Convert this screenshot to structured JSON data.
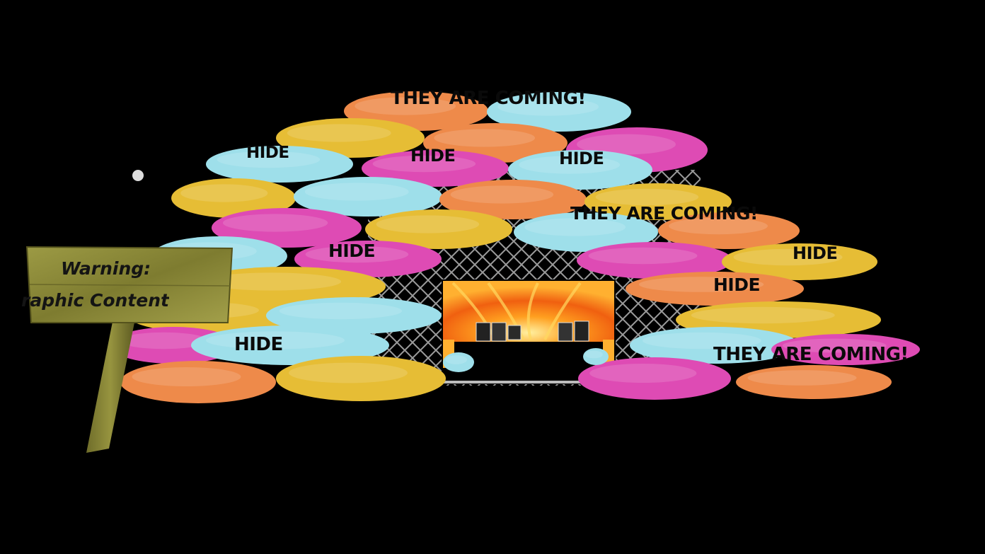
{
  "scene": {
    "banners": {
      "coming_1": "THEY ARE COMING!",
      "coming_2": "THEY ARE COMING!",
      "coming_3": "THEY ARE COMING!",
      "hide_1": "HIDE",
      "hide_2": "HIDE",
      "hide_3": "HIDE",
      "hide_4": "HIDE",
      "hide_5": "HIDE",
      "hide_6": "HIDE",
      "hide_7": "HIDE"
    },
    "sign": {
      "line1": "Warning:",
      "line2": "raphic Content"
    },
    "colors": {
      "background": "#000000",
      "cushion_orange": "#EE8A4A",
      "cushion_cyan": "#9EDFEA",
      "cushion_yellow": "#E6BD35",
      "cushion_magenta": "#DE4BB4",
      "sign_wood": "#8F8D3A",
      "fence_wire": "#9A9A9A"
    }
  }
}
